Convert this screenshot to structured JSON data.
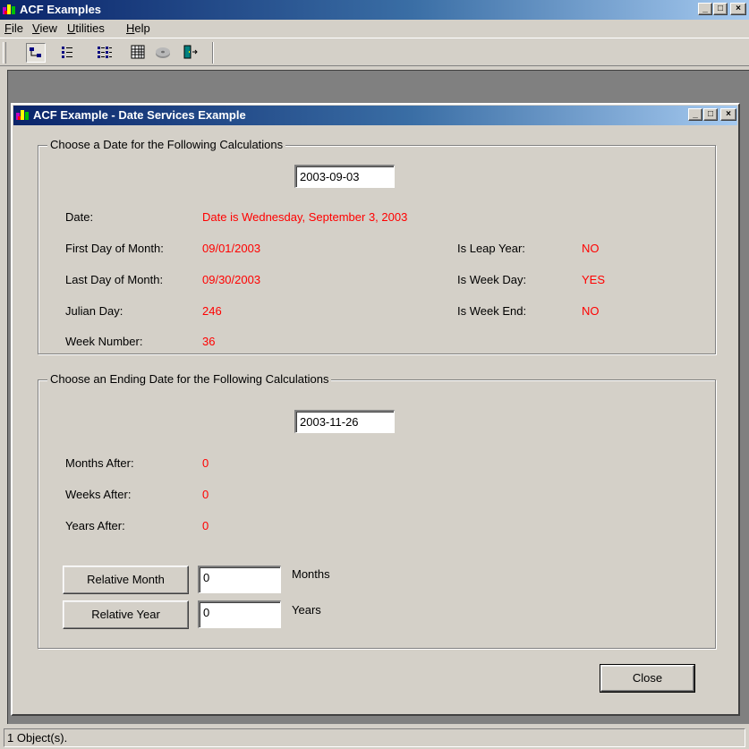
{
  "app": {
    "title": "ACF Examples",
    "menu": [
      {
        "label": "File",
        "acc": "F",
        "rest": "ile"
      },
      {
        "label": "View",
        "acc": "V",
        "rest": "iew"
      },
      {
        "label": "Utilities",
        "acc": "U",
        "rest": "tilities"
      },
      {
        "label": "Help",
        "acc": "H",
        "rest": "elp"
      }
    ],
    "toolbar": [
      "tree-view-icon",
      "list-view-icon",
      "details-view-icon",
      "grid-view-icon",
      "disk-icon",
      "exit-door-icon"
    ],
    "caption_buttons": {
      "minimize": "_",
      "maximize": "□",
      "close": "×"
    }
  },
  "child": {
    "title": "ACF Example - Date Services Example",
    "caption_buttons": {
      "minimize": "_",
      "maximize": "□",
      "close": "×"
    }
  },
  "group1": {
    "legend": "Choose a Date for the Following Calculations",
    "date_input": "2003-09-03",
    "date_label": "Date:",
    "date_value": "Date is Wednesday, September 3, 2003",
    "first_day_label": "First Day of Month:",
    "first_day_value": "09/01/2003",
    "last_day_label": "Last Day of Month:",
    "last_day_value": "09/30/2003",
    "julian_label": "Julian Day:",
    "julian_value": "246",
    "week_number_label": "Week Number:",
    "week_number_value": "36",
    "leap_year_label": "Is Leap Year:",
    "leap_year_value": "NO",
    "week_day_label": "Is Week Day:",
    "week_day_value": "YES",
    "week_end_label": "Is Week End:",
    "week_end_value": "NO"
  },
  "group2": {
    "legend": "Choose an Ending Date for the Following Calculations",
    "end_date_input": "2003-11-26",
    "months_after_label": "Months After:",
    "months_after_value": "0",
    "weeks_after_label": "Weeks After:",
    "weeks_after_value": "0",
    "years_after_label": "Years After:",
    "years_after_value": "0",
    "relative_month_button": "Relative Month",
    "relative_month_input": "0",
    "relative_month_unit": "Months",
    "relative_year_button": "Relative Year",
    "relative_year_input": "0",
    "relative_year_unit": "Years"
  },
  "close_button": "Close",
  "status": "1 Object(s).",
  "colors": {
    "value_red": "#ff0000",
    "title_gradient_start": "#0a246a",
    "title_gradient_end": "#a6caf0",
    "face": "#d4d0c8"
  }
}
